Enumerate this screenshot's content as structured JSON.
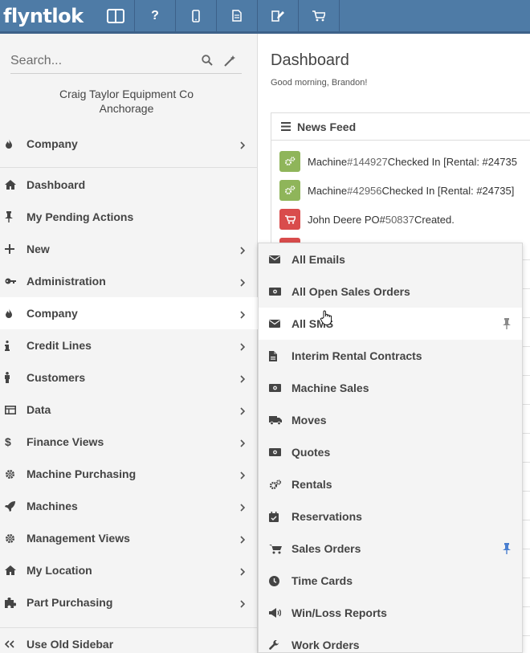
{
  "brand": {
    "logo_text": "flyntlok"
  },
  "toolbar": {
    "buttons": [
      {
        "name": "layout-icon"
      },
      {
        "name": "help-icon",
        "label": "?"
      },
      {
        "name": "mobile-icon"
      },
      {
        "name": "document-icon"
      },
      {
        "name": "edit-document-icon"
      },
      {
        "name": "cart-icon"
      }
    ]
  },
  "sidebar": {
    "search_placeholder": "Search...",
    "company_line1": "Craig Taylor Equipment Co",
    "company_line2": "Anchorage",
    "top_item": {
      "label": "Company",
      "icon": "fire-icon"
    },
    "items": [
      {
        "label": "Dashboard",
        "icon": "home-icon",
        "chevron": false
      },
      {
        "label": "My Pending Actions",
        "icon": "pin-icon",
        "chevron": false
      },
      {
        "label": "New",
        "icon": "plus-icon",
        "chevron": true
      },
      {
        "label": "Administration",
        "icon": "key-icon",
        "chevron": true
      },
      {
        "label": "Company",
        "icon": "fire-icon",
        "chevron": true,
        "active": true
      },
      {
        "label": "Credit Lines",
        "icon": "info-icon",
        "chevron": true
      },
      {
        "label": "Customers",
        "icon": "person-icon",
        "chevron": true
      },
      {
        "label": "Data",
        "icon": "table-icon",
        "chevron": true
      },
      {
        "label": "Finance Views",
        "icon": "dollar-icon",
        "chevron": true
      },
      {
        "label": "Machine Purchasing",
        "icon": "gear-icon",
        "chevron": true
      },
      {
        "label": "Machines",
        "icon": "rocket-icon",
        "chevron": true
      },
      {
        "label": "Management Views",
        "icon": "gear-icon",
        "chevron": true
      },
      {
        "label": "My Location",
        "icon": "home-icon",
        "chevron": true
      },
      {
        "label": "Part Purchasing",
        "icon": "puzzle-icon",
        "chevron": true
      }
    ],
    "footer_label": "Use Old Sidebar"
  },
  "main": {
    "title": "Dashboard",
    "greeting": "Good morning, Brandon!",
    "feed_title": "News Feed",
    "feed_rows": [
      {
        "prefix": "Machine ",
        "num": "#144927",
        "suffix": " Checked In [Rental: #24735",
        "color": "green"
      },
      {
        "prefix": "Machine ",
        "num": "#42956",
        "suffix": " Checked In [Rental: #24735]",
        "color": "green"
      },
      {
        "prefix": "John Deere PO# ",
        "num": "50837",
        "suffix": " Created.",
        "color": "red"
      }
    ],
    "peek_fragments": [
      "[1",
      "n",
      "C",
      "d",
      "0:"
    ]
  },
  "submenu": {
    "items": [
      {
        "label": "All Emails",
        "icon": "envelope-icon"
      },
      {
        "label": "All Open Sales Orders",
        "icon": "money-icon"
      },
      {
        "label": "All SMS",
        "icon": "envelope-icon",
        "hover": true,
        "pinned": "grey"
      },
      {
        "label": "Interim Rental Contracts",
        "icon": "file-icon"
      },
      {
        "label": "Machine Sales",
        "icon": "money-icon"
      },
      {
        "label": "Moves",
        "icon": "truck-icon"
      },
      {
        "label": "Quotes",
        "icon": "money-icon"
      },
      {
        "label": "Rentals",
        "icon": "gears-icon"
      },
      {
        "label": "Reservations",
        "icon": "calendar-icon"
      },
      {
        "label": "Sales Orders",
        "icon": "cart-icon",
        "pinned": "blue"
      },
      {
        "label": "Time Cards",
        "icon": "clock-icon"
      },
      {
        "label": "Win/Loss Reports",
        "icon": "megaphone-icon"
      },
      {
        "label": "Work Orders",
        "icon": "wrench-icon"
      }
    ]
  },
  "colors": {
    "topbar": "#4e7ba6",
    "feed_green": "#8fb55a",
    "feed_red": "#d94c4c",
    "pin_blue": "#4a7fd0"
  }
}
